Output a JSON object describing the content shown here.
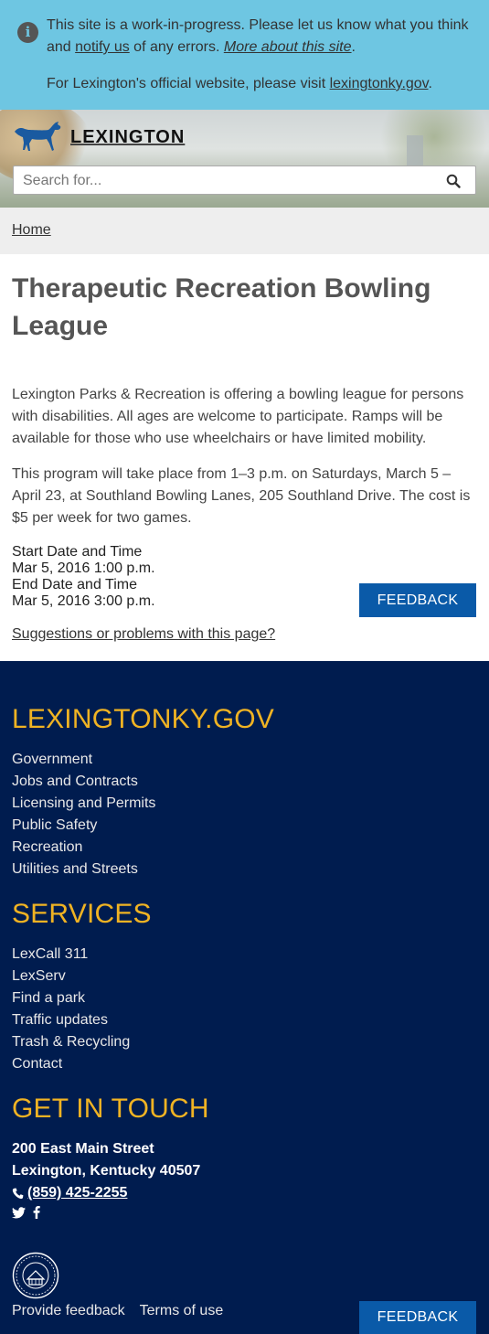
{
  "alert": {
    "line1_pre": "This site is a work-in-progress. Please let us know what you think and ",
    "notify_link": "notify us",
    "line1_mid": " of any errors. ",
    "more_link": "More about this site",
    "line1_end": ".",
    "line2_pre": "For Lexington's official website, please visit ",
    "official_link": "lexingtonky.gov",
    "line2_end": "."
  },
  "header": {
    "logo_text": "LEXINGTON",
    "logo_icon": "horse-icon",
    "search_placeholder": "Search for...",
    "search_icon": "search-icon"
  },
  "breadcrumb": {
    "home": "Home"
  },
  "main": {
    "title": "Therapeutic Recreation Bowling League",
    "para1": "Lexington Parks & Recreation is offering a bowling league for persons with disabilities. All ages are welcome to participate. Ramps will be available for those who use wheelchairs or have limited mobility.",
    "para2": "This program will take place from 1–3 p.m. on Saturdays, March 5 – April 23, at Southland Bowling Lanes, 205 Southland Drive. The cost is $5 per week for two games.",
    "start_label": "Start Date and Time",
    "start_value": "Mar 5, 2016 1:00 p.m.",
    "end_label": "End Date and Time",
    "end_value": "Mar 5, 2016 3:00 p.m.",
    "feedback_button": "FEEDBACK",
    "suggest_link": "Suggestions or problems with this page?"
  },
  "footer": {
    "site_heading": "LEXINGTONKY.GOV",
    "site_links": [
      "Government",
      "Jobs and Contracts",
      "Licensing and Permits",
      "Public Safety",
      "Recreation",
      "Utilities and Streets"
    ],
    "services_heading": "SERVICES",
    "services_links": [
      "LexCall 311",
      "LexServ",
      "Find a park",
      "Traffic updates",
      "Trash & Recycling",
      "Contact"
    ],
    "touch_heading": "GET IN TOUCH",
    "address1": "200 East Main Street",
    "address2": "Lexington, Kentucky 40507",
    "phone": "(859) 425-2255",
    "social_icons": [
      "twitter-icon",
      "facebook-icon"
    ],
    "bottom_links": [
      "Provide feedback",
      "Terms of use"
    ],
    "feedback_button": "FEEDBACK",
    "colors": {
      "background": "#001c4f",
      "heading": "#f0b323",
      "button": "#0a5aa8"
    }
  }
}
